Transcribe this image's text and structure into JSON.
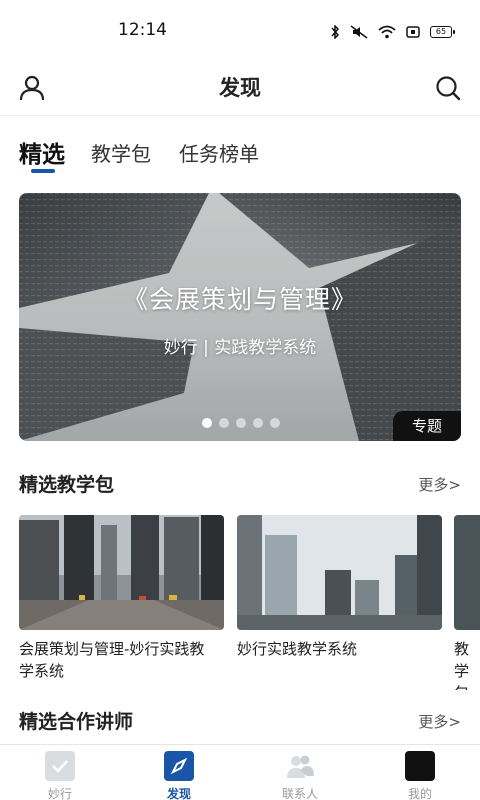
{
  "status_bar": {
    "time": "12:14",
    "battery": "65"
  },
  "header": {
    "title": "发现"
  },
  "tabs": [
    {
      "label": "精选",
      "active": true
    },
    {
      "label": "教学包",
      "active": false
    },
    {
      "label": "任务榜单",
      "active": false
    }
  ],
  "banner": {
    "title": "《会展策划与管理》",
    "subtitle": "妙行 | 实践教学系统",
    "tag": "专题",
    "slide_count": 5,
    "active_slide": 1
  },
  "section_packages": {
    "title": "精选教学包",
    "more": "更多>"
  },
  "cards": [
    {
      "title": "会展策划与管理-妙行实践教学系统"
    },
    {
      "title": "妙行实践教学系统"
    },
    {
      "title": "教学包标"
    }
  ],
  "section_teachers": {
    "title": "精选合作讲师",
    "more": "更多>"
  },
  "bottom_nav": [
    {
      "label": "妙行",
      "active": false
    },
    {
      "label": "发现",
      "active": true
    },
    {
      "label": "联系人",
      "active": false
    },
    {
      "label": "我的",
      "active": false
    }
  ],
  "colors": {
    "accent": "#1a56a8",
    "text": "#222222",
    "muted": "#999999"
  }
}
